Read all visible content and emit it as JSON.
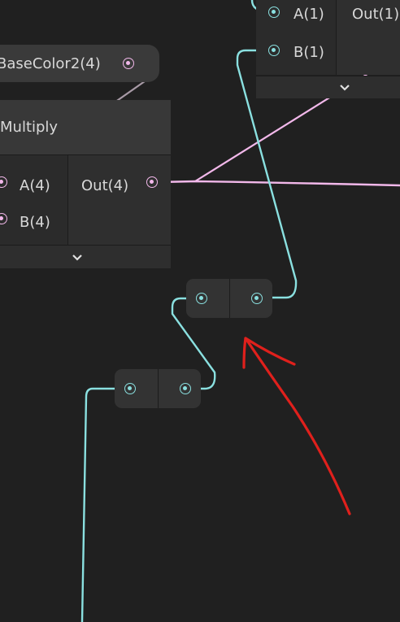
{
  "nodes": {
    "top_right": {
      "inputs": [
        {
          "label": "A(1)"
        },
        {
          "label": "B(1)"
        }
      ],
      "output": {
        "label": "Out(1)"
      }
    },
    "base_color_property": {
      "label": "BaseColor2(4)"
    },
    "multiply": {
      "title": "Multiply",
      "inputs": [
        {
          "label": "A(4)"
        },
        {
          "label": "B(4)"
        }
      ],
      "output": {
        "label": "Out(4)"
      }
    }
  },
  "colors": {
    "background": "#202020",
    "vector_wire": "#f2b8ea",
    "float_wire": "#8ae0e0",
    "annotation_arrow": "#e0201c"
  },
  "icons": {
    "expand": "chevron-down-icon",
    "port": "port-dot-icon"
  }
}
